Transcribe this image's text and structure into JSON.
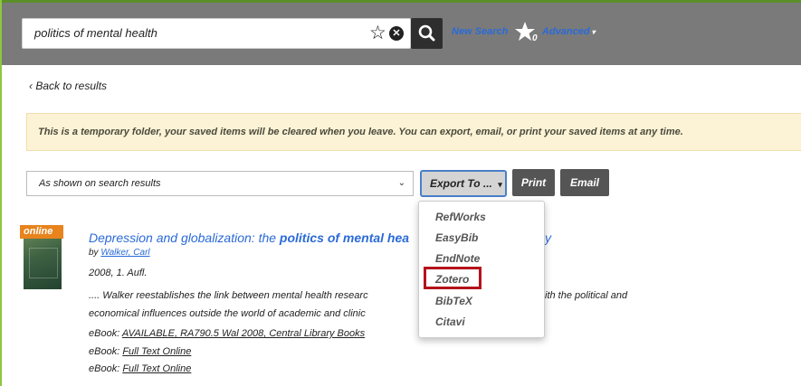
{
  "search": {
    "query": "politics of mental health",
    "new_search_label": "New Search",
    "starred_count": "0",
    "advanced_label": "Advanced"
  },
  "nav": {
    "back_label": "‹ Back to results"
  },
  "notice": {
    "text": "This is a temporary folder, your saved items will be cleared when you leave. You can export, email, or print your saved items at any time."
  },
  "toolbar": {
    "selection_value": "As shown on search results",
    "export_label": "Export To ...",
    "print_label": "Print",
    "email_label": "Email"
  },
  "export_menu": {
    "items": [
      "RefWorks",
      "EasyBib",
      "EndNote",
      "Zotero",
      "BibTeX",
      "Citavi"
    ],
    "highlighted": "Zotero",
    "highlight_color": "#b5121b"
  },
  "result": {
    "badge": "online",
    "title_start": "Depression and globalization: the ",
    "title_highlight": "politics of mental hea",
    "title_end": "y",
    "by_label": "by",
    "author": "Walker, Carl",
    "edition": "2008, 1. Aufl.",
    "snippet_line1": ".... Walker reestablishes the link between mental health researc",
    "snippet_line1_end": "ith the political and",
    "snippet_line2": "economical influences outside the world of academic and clinic",
    "holdings": [
      {
        "prefix": "eBook: ",
        "link": "AVAILABLE, RA790.5 Wal 2008, Central Library Books"
      },
      {
        "prefix": "eBook: ",
        "link": "Full Text Online"
      },
      {
        "prefix": "eBook: ",
        "link": "Full Text Online"
      }
    ]
  },
  "colors": {
    "top_bar": "#7a7a7a",
    "link_blue": "#2a6ad8",
    "notice_bg": "#fcf3d7",
    "badge_orange": "#e8831d"
  }
}
